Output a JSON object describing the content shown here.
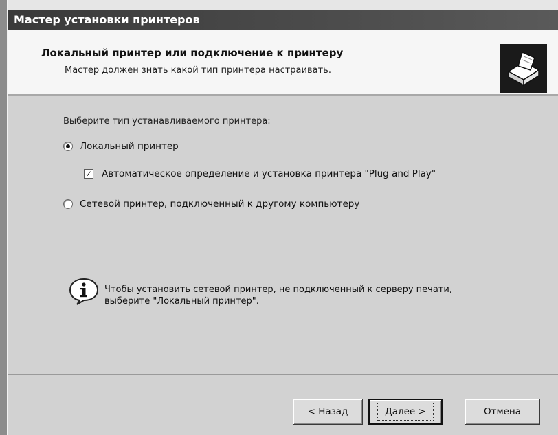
{
  "window": {
    "title": "Мастер установки принтеров"
  },
  "header": {
    "title": "Локальный принтер или подключение к принтеру",
    "subtitle": "Мастер должен знать какой тип принтера настраивать."
  },
  "body": {
    "prompt": "Выберите тип устанавливаемого принтера:",
    "options": [
      {
        "label": "Локальный принтер",
        "selected": true
      },
      {
        "label": "Сетевой принтер, подключенный к другому компьютеру",
        "selected": false
      }
    ],
    "plug_and_play": {
      "label": "Автоматическое определение и установка принтера \"Plug and Play\"",
      "checked": true
    },
    "info": {
      "line1": "Чтобы установить сетевой принтер, не подключенный к серверу печати,",
      "line2": "выберите \"Локальный принтер\"."
    }
  },
  "footer": {
    "back_label": "< Назад",
    "next_label": "Далее >",
    "cancel_label": "Отмена"
  },
  "icons": {
    "header_icon": "printer-icon",
    "info_icon": "info-icon"
  }
}
